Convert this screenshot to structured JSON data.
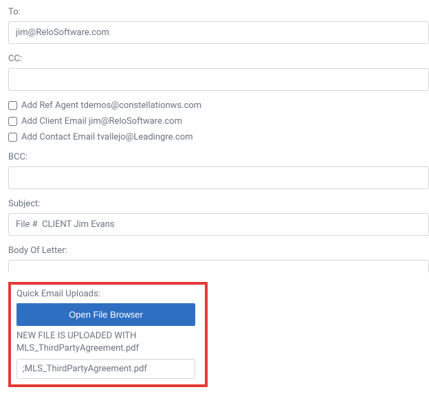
{
  "to": {
    "label": "To:",
    "value": "jim@ReloSoftware.com"
  },
  "cc": {
    "label": "CC:",
    "value": ""
  },
  "ccOptions": [
    {
      "label": "Add Ref Agent tdemos@constellationws.com"
    },
    {
      "label": "Add Client Email jim@ReloSoftware.com"
    },
    {
      "label": "Add Contact Email tvallejo@Leadingre.com"
    }
  ],
  "bcc": {
    "label": "BCC:",
    "value": ""
  },
  "subject": {
    "label": "Subject:",
    "value": "File #  CLIENT Jim Evans"
  },
  "body": {
    "label": "Body Of Letter:",
    "value": ""
  },
  "uploads": {
    "label": "Quick Email Uploads:",
    "button": "Open File Browser",
    "statusLine1": "NEW FILE IS UPLOADED WITH",
    "statusLine2": "MLS_ThirdPartyAgreement.pdf",
    "fileValue": ";MLS_ThirdPartyAgreement.pdf"
  }
}
